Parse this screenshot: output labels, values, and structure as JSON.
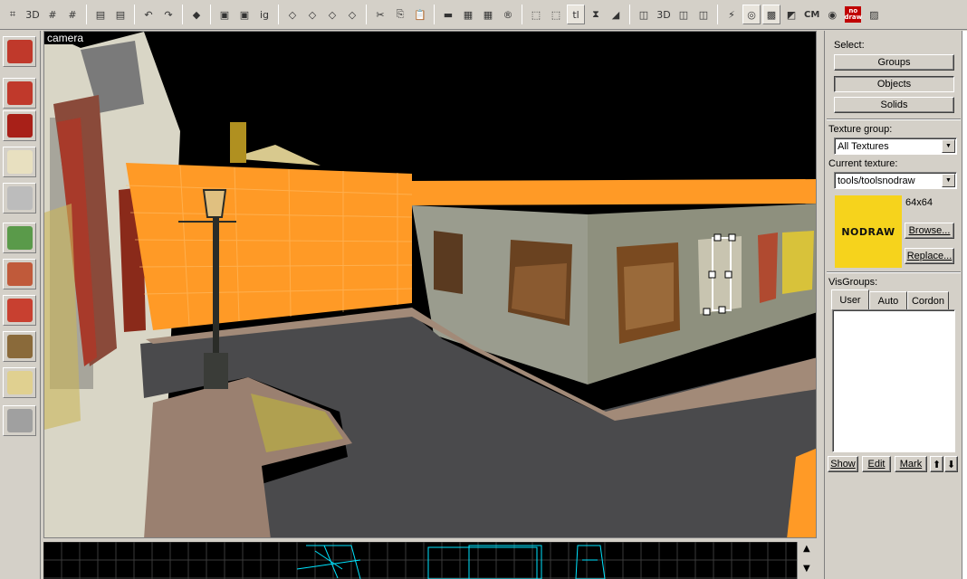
{
  "toolbar": {
    "buttons": [
      {
        "name": "grid-toggle-icon",
        "glyph": "⌗"
      },
      {
        "name": "3d-grid-icon",
        "glyph": "3D"
      },
      {
        "name": "grid-smaller-icon",
        "glyph": "#"
      },
      {
        "name": "grid-larger-icon",
        "glyph": "#"
      },
      {
        "sep": true
      },
      {
        "name": "load-window-state-icon",
        "glyph": "▤"
      },
      {
        "name": "save-window-state-icon",
        "glyph": "▤"
      },
      {
        "sep": true
      },
      {
        "name": "undo-icon",
        "glyph": "↶"
      },
      {
        "name": "redo-icon",
        "glyph": "↷"
      },
      {
        "sep": true
      },
      {
        "name": "carve-icon",
        "glyph": "◆"
      },
      {
        "sep": true
      },
      {
        "name": "group-icon",
        "glyph": "▣"
      },
      {
        "name": "ungroup-icon",
        "glyph": "▣"
      },
      {
        "name": "ignore-grouping-icon",
        "glyph": "ig"
      },
      {
        "sep": true
      },
      {
        "name": "hide-selected-icon",
        "glyph": "◇"
      },
      {
        "name": "hide-unselected-icon",
        "glyph": "◇"
      },
      {
        "name": "show-all-icon",
        "glyph": "◇"
      },
      {
        "name": "show-hidden-icon",
        "glyph": "◇"
      },
      {
        "sep": true
      },
      {
        "name": "cut-icon",
        "glyph": "✂"
      },
      {
        "name": "copy-icon",
        "glyph": "⎘"
      },
      {
        "name": "paste-icon",
        "glyph": "📋"
      },
      {
        "sep": true
      },
      {
        "name": "toggle-texture-lock-icon",
        "glyph": "▬"
      },
      {
        "name": "hide-textures-icon",
        "glyph": "▦"
      },
      {
        "name": "show-models-icon",
        "glyph": "▦"
      },
      {
        "name": "radius-culling-icon",
        "glyph": "®"
      },
      {
        "sep": true
      },
      {
        "name": "select-box-icon",
        "glyph": "⬚"
      },
      {
        "name": "texture-application-icon",
        "glyph": "⬚"
      },
      {
        "name": "ignore-texlock-icon",
        "glyph": "tl",
        "active": true
      },
      {
        "name": "clip-icon",
        "glyph": "⧗"
      },
      {
        "name": "vertex-edit-icon",
        "glyph": "◢"
      },
      {
        "sep": true
      },
      {
        "name": "display-2d-icon",
        "glyph": "◫"
      },
      {
        "name": "display-3d-icon",
        "glyph": "3D"
      },
      {
        "name": "display-wireframe-icon",
        "glyph": "◫"
      },
      {
        "name": "display-textured-icon",
        "glyph": "◫"
      },
      {
        "sep": true
      },
      {
        "name": "helpers-icon",
        "glyph": "⚡"
      },
      {
        "name": "entity-report-icon",
        "glyph": "◎",
        "active": true
      },
      {
        "name": "check-problems-icon",
        "glyph": "▩",
        "active": true
      },
      {
        "name": "map-info-icon",
        "glyph": "◩"
      },
      {
        "name": "cordon-icon",
        "glyph": "CM",
        "text": true
      },
      {
        "name": "find-entities-icon",
        "glyph": "◉"
      },
      {
        "name": "no-draw-icon",
        "badge": "no\ndraw"
      },
      {
        "name": "run-map-icon",
        "glyph": "▨"
      }
    ]
  },
  "viewport": {
    "camera_label": "camera"
  },
  "tools": [
    {
      "name": "pointer-tool-icon",
      "color": "#c0392b"
    },
    {
      "name": "magnify-tool-icon",
      "color": "#c0392b"
    },
    {
      "name": "camera-tool-icon",
      "color": "#a82018"
    },
    {
      "name": "entity-tool-icon",
      "color": "#e8e0c0"
    },
    {
      "name": "block-tool-icon",
      "color": "#bcbcbc"
    },
    {
      "name": "texture-application-tool-icon",
      "color": "#5a9a4a"
    },
    {
      "name": "apply-decal-tool-icon",
      "color": "#c05a3a"
    },
    {
      "name": "apply-overlay-tool-icon",
      "color": "#c84030"
    },
    {
      "name": "clipping-tool-icon",
      "color": "#8a6a3a"
    },
    {
      "name": "vertex-tool-icon",
      "color": "#e0d090"
    },
    {
      "name": "path-tool-icon",
      "color": "#a0a0a0"
    }
  ],
  "panel": {
    "select_label": "Select:",
    "buttons": {
      "groups": "Groups",
      "objects": "Objects",
      "solids": "Solids"
    },
    "texture_group_label": "Texture group:",
    "texture_group_value": "All Textures",
    "current_texture_label": "Current texture:",
    "current_texture_value": "tools/toolsnodraw",
    "texture_size": "64x64",
    "texture_preview_text": "NODRAW",
    "browse_button": "Browse...",
    "replace_button": "Replace...",
    "visgroups_label": "VisGroups:",
    "tabs": {
      "user": "User",
      "auto": "Auto",
      "cordon": "Cordon"
    },
    "bottom_buttons": {
      "show": "Show",
      "edit": "Edit",
      "mark": "Mark"
    }
  }
}
